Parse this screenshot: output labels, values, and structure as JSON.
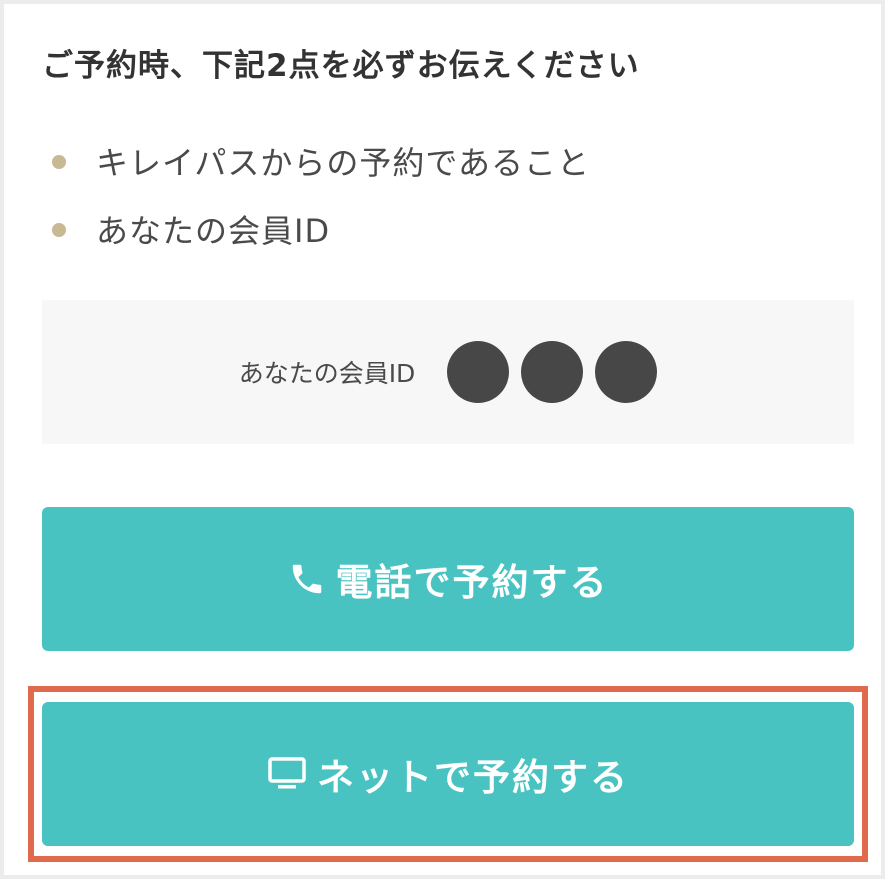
{
  "reservation_notice": {
    "heading": "ご予約時、下記2点を必ずお伝えください",
    "items": [
      {
        "label": "キレイパスからの予約であること"
      },
      {
        "label": "あなたの会員ID"
      }
    ]
  },
  "member_id": {
    "label": "あなたの会員ID",
    "value": "●●●"
  },
  "buttons": {
    "phone": {
      "label": "電話で予約する",
      "icon": "phone-icon"
    },
    "net": {
      "label": "ネットで予約する",
      "icon": "monitor-icon"
    }
  },
  "colors": {
    "button_bg": "#49c3c2",
    "bullet": "#c8b893",
    "highlight_border": "#e06a4e",
    "id_box_bg": "#f7f7f7"
  }
}
